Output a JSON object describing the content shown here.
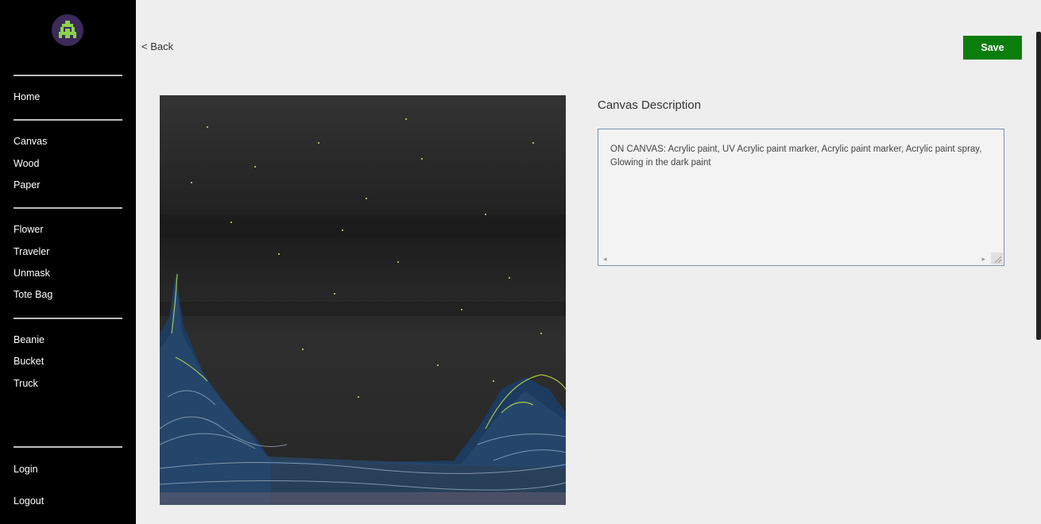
{
  "sidebar": {
    "logo_icon": "pixel-invader-icon",
    "items": [
      {
        "label": "Home",
        "group": 1
      },
      {
        "label": "Canvas",
        "group": 2
      },
      {
        "label": "Wood",
        "group": 2
      },
      {
        "label": "Paper",
        "group": 2
      },
      {
        "label": "Flower",
        "group": 3
      },
      {
        "label": "Traveler",
        "group": 3
      },
      {
        "label": "Unmask",
        "group": 3
      },
      {
        "label": "Tote Bag",
        "group": 3
      },
      {
        "label": "Beanie",
        "group": 4
      },
      {
        "label": "Bucket",
        "group": 4
      },
      {
        "label": "Truck",
        "group": 4
      },
      {
        "label": "Login",
        "group": 5
      },
      {
        "label": "Logout",
        "group": 5
      }
    ]
  },
  "header": {
    "back_label": "< Back",
    "save_label": "Save"
  },
  "detail": {
    "description_label": "Canvas Description",
    "description_value": "ON CANVAS: Acrylic paint, UV Acrylic paint marker, Acrylic paint marker, Acrylic paint spray, Glowing in the dark paint"
  },
  "colors": {
    "sidebar_bg": "#000000",
    "page_bg": "#eeeeee",
    "save_bg": "#0b7d0b",
    "logo_green": "#8bd44a"
  }
}
